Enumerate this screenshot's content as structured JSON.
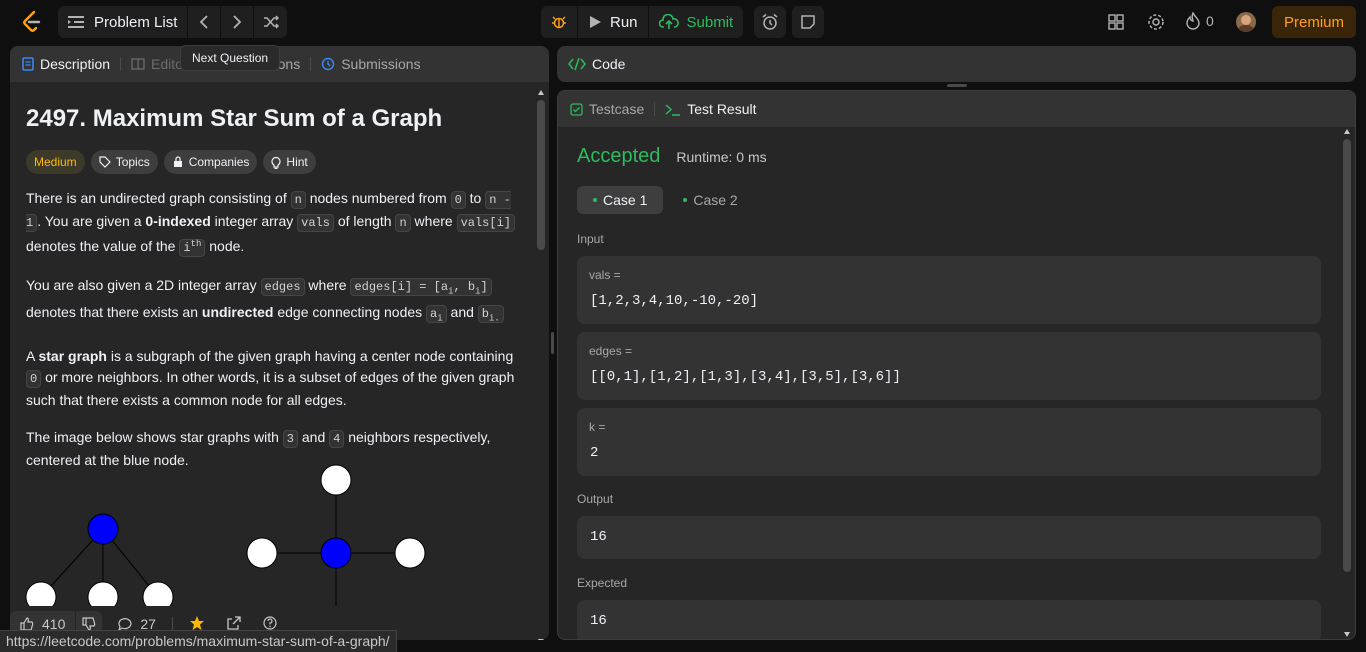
{
  "topbar": {
    "problem_list": "Problem List",
    "tooltip": "Next Question",
    "run": "Run",
    "submit": "Submit",
    "streak": "0",
    "premium": "Premium"
  },
  "left_tabs": [
    "Description",
    "Editorial",
    "Solutions",
    "Submissions"
  ],
  "problem": {
    "title": "2497. Maximum Star Sum of a Graph",
    "difficulty": "Medium",
    "chips": [
      "Topics",
      "Companies",
      "Hint"
    ],
    "p1": {
      "a": "There is an undirected graph consisting of ",
      "n": "n",
      "b": " nodes numbered from ",
      "zero": "0",
      "c": " to ",
      "n1": "n - 1",
      "d": ". You are given a ",
      "bold": "0-indexed",
      "e": " integer array ",
      "vals": "vals",
      "f": " of length ",
      "n2": "n",
      "g": " where ",
      "valsi": "vals[i]",
      "h": " denotes the value of the ",
      "ith": "i",
      "th": "th",
      "j": " node."
    },
    "p2": {
      "a": "You are also given a 2D integer array ",
      "edges": "edges",
      "b": " where ",
      "edgesi": "edges[i] = [a",
      "sub_i": "i",
      "comma": ", b",
      "sub_i2": "i",
      "close": "]",
      "c": " denotes that there exists an ",
      "bold": "undirected",
      "d": " edge connecting nodes ",
      "ai": "a",
      "ai_sub": "i",
      "e": " and ",
      "bi": "b",
      "bi_sub": "i."
    },
    "p3": {
      "a": "A ",
      "bold": "star graph",
      "b": " is a subgraph of the given graph having a center node containing ",
      "zero": "0",
      "c": " or more neighbors. In other words, it is a subset of edges of the given graph such that there exists a common node for all edges."
    },
    "p4": {
      "a": "The image below shows star graphs with ",
      "three": "3",
      "b": " and ",
      "four": "4",
      "c": " neighbors respectively, centered at the blue node."
    }
  },
  "footer": {
    "likes": "410",
    "comments": "27",
    "url": "https://leetcode.com/problems/maximum-star-sum-of-a-graph/"
  },
  "code_panel": {
    "title": "Code"
  },
  "result_panel": {
    "tabs": [
      "Testcase",
      "Test Result"
    ],
    "status": "Accepted",
    "runtime": "Runtime: 0 ms",
    "cases": [
      "Case 1",
      "Case 2"
    ],
    "input_label": "Input",
    "inputs": [
      {
        "name": "vals =",
        "value": "[1,2,3,4,10,-10,-20]"
      },
      {
        "name": "edges =",
        "value": "[[0,1],[1,2],[1,3],[3,4],[3,5],[3,6]]"
      },
      {
        "name": "k =",
        "value": "2"
      }
    ],
    "output_label": "Output",
    "output": "16",
    "expected_label": "Expected",
    "expected": "16"
  },
  "colors": {
    "accepted": "#2cbb5d",
    "accent_orange": "#ffa116",
    "blue_node": "#0000ff",
    "link_blue": "#3c88f6"
  }
}
